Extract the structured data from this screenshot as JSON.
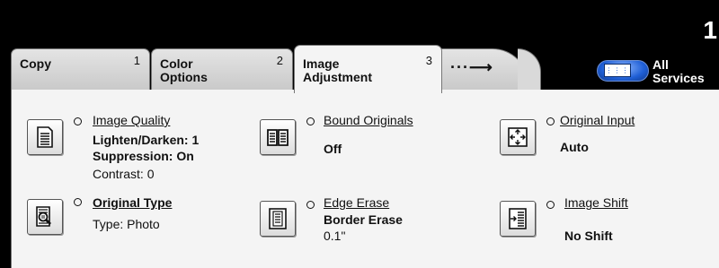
{
  "header": {
    "page_number": "1"
  },
  "tabs": [
    {
      "label_line1": "Copy",
      "label_line2": "",
      "number": "1"
    },
    {
      "label_line1": "Color",
      "label_line2": "Options",
      "number": "2"
    },
    {
      "label_line1": "Image",
      "label_line2": "Adjustment",
      "number": "3",
      "selected": true
    },
    {
      "label": "···⟶"
    }
  ],
  "all_services": {
    "label_line1": "All",
    "label_line2": "Services",
    "icon": "all-services-icon"
  },
  "features": {
    "image_quality": {
      "title": "Image Quality",
      "lines": [
        "Lighten/Darken: 1",
        "Suppression: On",
        "Contrast: 0"
      ],
      "icon": "document-icon"
    },
    "bound_originals": {
      "title": "Bound Originals",
      "lines": [
        "Off"
      ],
      "icon": "open-book-icon"
    },
    "original_input": {
      "title": "Original Input",
      "lines": [
        "Auto"
      ],
      "icon": "arrows-frame-icon"
    },
    "original_type": {
      "title": "Original Type",
      "lines": [
        "Type: Photo"
      ],
      "icon": "magnifier-document-icon"
    },
    "edge_erase": {
      "title": "Edge Erase",
      "lines": [
        "Border Erase",
        "0.1\""
      ],
      "icon": "edge-erase-icon"
    },
    "image_shift": {
      "title": "Image Shift",
      "lines": [
        "No Shift"
      ],
      "icon": "image-shift-icon"
    }
  }
}
